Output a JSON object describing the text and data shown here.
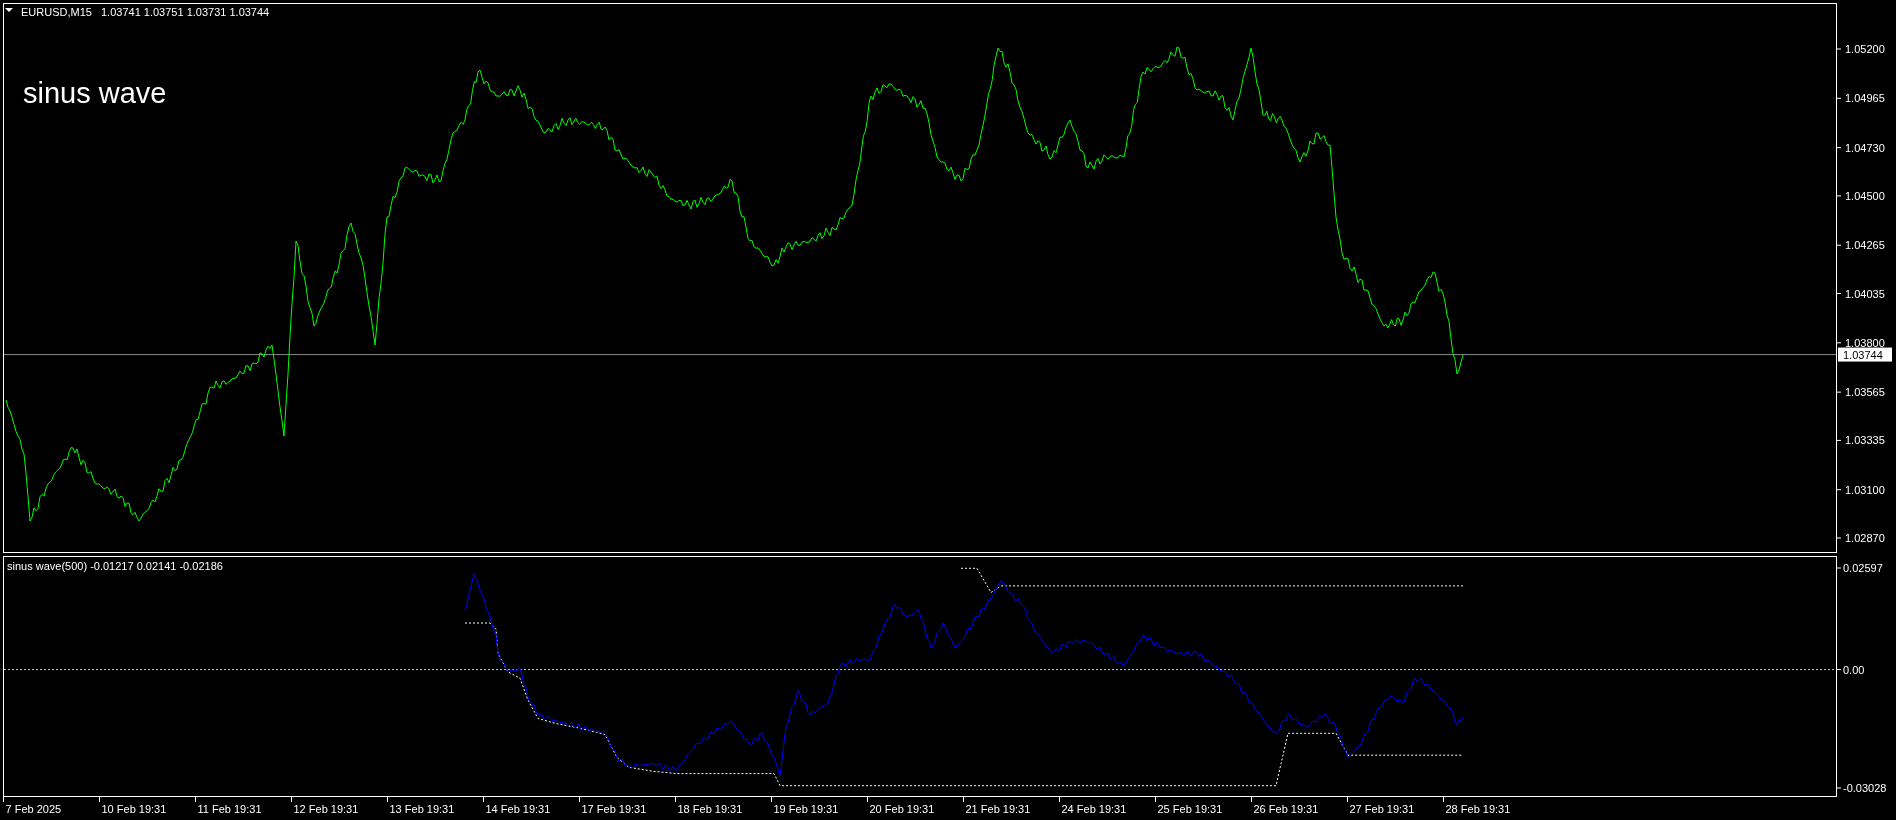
{
  "header": {
    "symbol": "EURUSD,M15",
    "ohlc": "1.03741 1.03751 1.03731 1.03744"
  },
  "chart_label": "sinus wave",
  "price_axis": [
    "1.05200",
    "1.04965",
    "1.04730",
    "1.04500",
    "1.04265",
    "1.04035",
    "1.03800",
    "1.03565",
    "1.03335",
    "1.03100",
    "1.02870"
  ],
  "current_price": "1.03744",
  "indicator": {
    "label": "sinus wave(500) -0.01217 0.02141 -0.02186",
    "axis": [
      "0.02597",
      "0.00",
      "-0.03028"
    ]
  },
  "time_axis": [
    "7 Feb 2025",
    "10 Feb 19:31",
    "11 Feb 19:31",
    "12 Feb 19:31",
    "13 Feb 19:31",
    "14 Feb 19:31",
    "17 Feb 19:31",
    "18 Feb 19:31",
    "19 Feb 19:31",
    "20 Feb 19:31",
    "21 Feb 19:31",
    "24 Feb 19:31",
    "25 Feb 19:31",
    "26 Feb 19:31",
    "27 Feb 19:31",
    "28 Feb 19:31"
  ]
}
